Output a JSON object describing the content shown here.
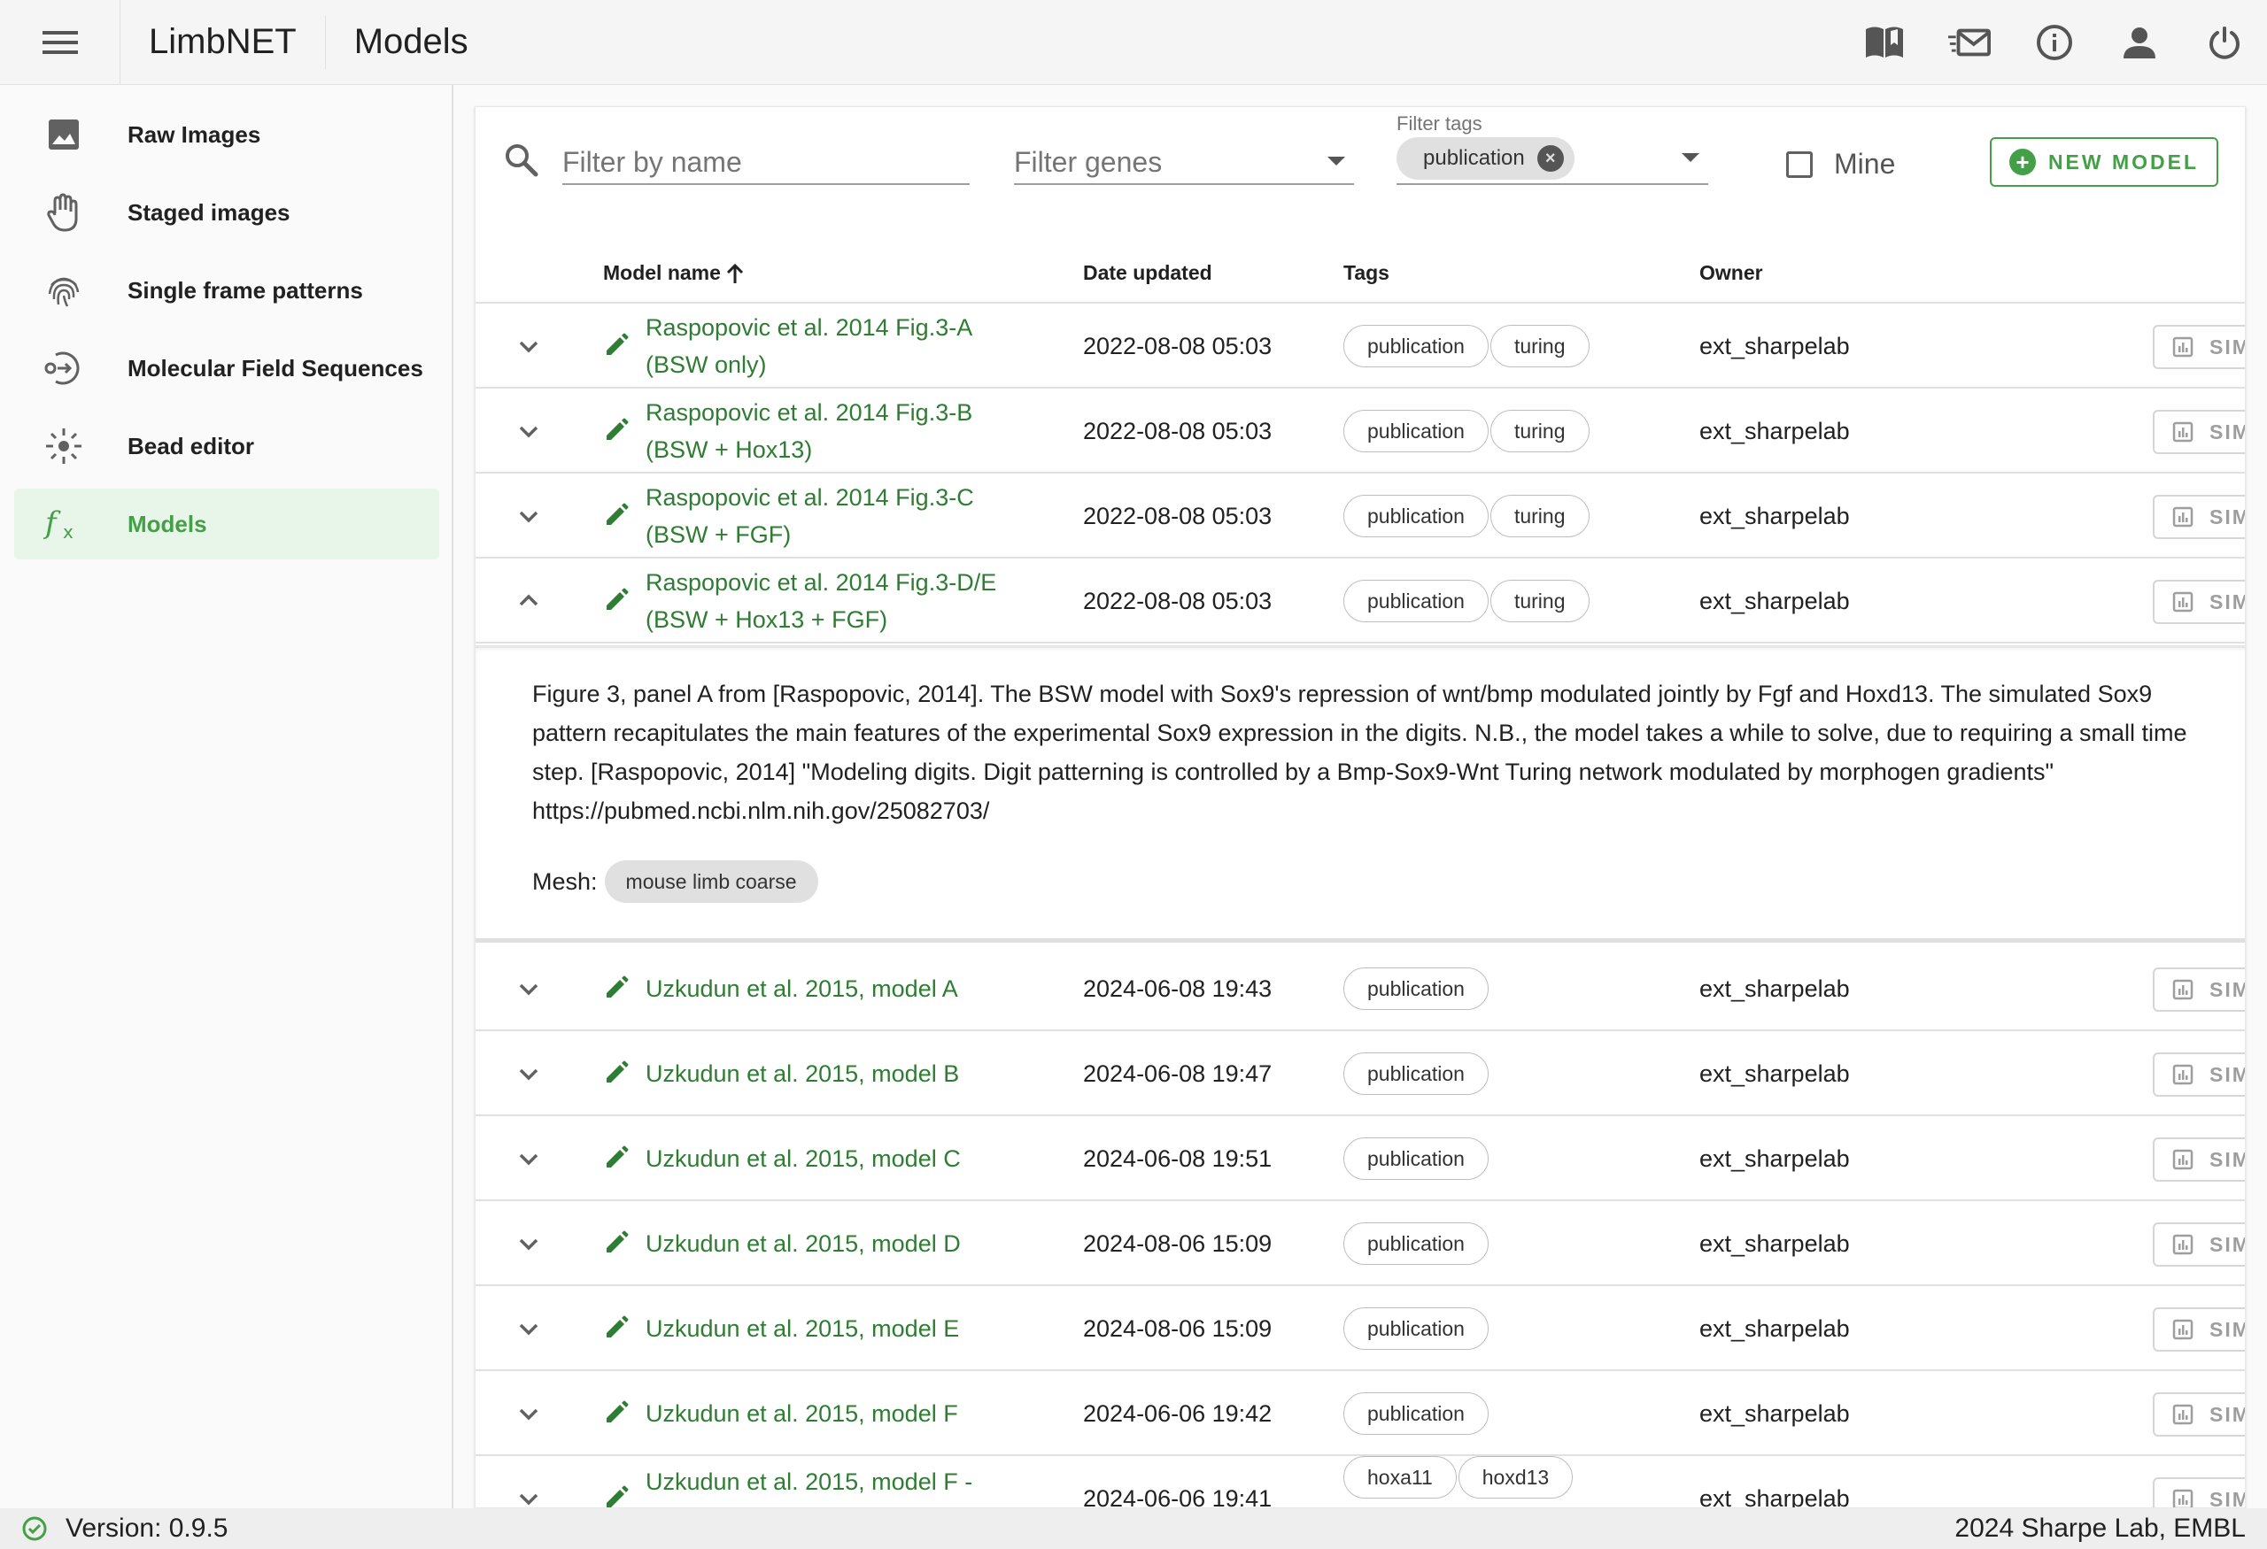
{
  "header": {
    "app_title": "LimbNET",
    "page_title": "Models",
    "icons": [
      "menu-icon",
      "book-icon",
      "mail-icon",
      "info-icon",
      "account-icon",
      "power-icon"
    ]
  },
  "sidebar": {
    "items": [
      {
        "label": "Raw Images",
        "icon": "image-icon"
      },
      {
        "label": "Staged images",
        "icon": "hand-icon"
      },
      {
        "label": "Single frame patterns",
        "icon": "fingerprint-icon"
      },
      {
        "label": "Molecular Field Sequences",
        "icon": "sequence-icon"
      },
      {
        "label": "Bead editor",
        "icon": "bead-icon"
      },
      {
        "label": "Models",
        "icon": "function-icon",
        "active": true
      }
    ]
  },
  "filters": {
    "name_placeholder": "Filter by name",
    "genes_placeholder": "Filter genes",
    "tags_label": "Filter tags",
    "tags_selected": [
      "publication"
    ],
    "mine_label": "Mine",
    "new_model_label": "NEW MODEL"
  },
  "table": {
    "headers": {
      "name": "Model name",
      "date": "Date updated",
      "tags": "Tags",
      "owner": "Owner"
    },
    "sim_label": "SIM",
    "rows": [
      {
        "name": "Raspopovic et al. 2014 Fig.3-A (BSW only)",
        "date": "2022-08-08 05:03",
        "tags": [
          "publication",
          "turing"
        ],
        "owner": "ext_sharpelab"
      },
      {
        "name": "Raspopovic et al. 2014 Fig.3-B (BSW + Hox13)",
        "date": "2022-08-08 05:03",
        "tags": [
          "publication",
          "turing"
        ],
        "owner": "ext_sharpelab"
      },
      {
        "name": "Raspopovic et al. 2014 Fig.3-C (BSW + FGF)",
        "date": "2022-08-08 05:03",
        "tags": [
          "publication",
          "turing"
        ],
        "owner": "ext_sharpelab"
      },
      {
        "name": "Raspopovic et al. 2014 Fig.3-D/E (BSW + Hox13 + FGF)",
        "date": "2022-08-08 05:03",
        "tags": [
          "publication",
          "turing"
        ],
        "owner": "ext_sharpelab",
        "expanded": true
      },
      {
        "name": "Uzkudun et al. 2015, model A",
        "date": "2024-06-08 19:43",
        "tags": [
          "publication"
        ],
        "owner": "ext_sharpelab"
      },
      {
        "name": "Uzkudun et al. 2015, model B",
        "date": "2024-06-08 19:47",
        "tags": [
          "publication"
        ],
        "owner": "ext_sharpelab"
      },
      {
        "name": "Uzkudun et al. 2015, model C",
        "date": "2024-06-08 19:51",
        "tags": [
          "publication"
        ],
        "owner": "ext_sharpelab"
      },
      {
        "name": "Uzkudun et al. 2015, model D",
        "date": "2024-08-06 15:09",
        "tags": [
          "publication"
        ],
        "owner": "ext_sharpelab"
      },
      {
        "name": "Uzkudun et al. 2015, model E",
        "date": "2024-08-06 15:09",
        "tags": [
          "publication"
        ],
        "owner": "ext_sharpelab"
      },
      {
        "name": "Uzkudun et al. 2015, model F",
        "date": "2024-06-06 19:42",
        "tags": [
          "publication"
        ],
        "owner": "ext_sharpelab"
      },
      {
        "name": "Uzkudun et al. 2015, model F -",
        "date": "2024-06-06 19:41",
        "tags": [
          "hoxa11",
          "hoxd13"
        ],
        "owner": "ext_sharpelab"
      }
    ],
    "detail": {
      "description": "Figure 3, panel A from [Raspopovic, 2014]. The BSW model with Sox9's repression of wnt/bmp modulated jointly by Fgf and Hoxd13. The simulated Sox9 pattern recapitulates the main features of the experimental Sox9 expression in the digits. N.B., the model takes a while to solve, due to requiring a small time step. [Raspopovic, 2014] \"Modeling digits. Digit patterning is controlled by a Bmp-Sox9-Wnt Turing network modulated by morphogen gradients\" https://pubmed.ncbi.nlm.nih.gov/25082703/",
      "mesh_label": "Mesh:",
      "mesh_value": "mouse limb coarse"
    }
  },
  "footer": {
    "version": "Version: 0.9.5",
    "copyright": "2024 Sharpe Lab, EMBL"
  },
  "colors": {
    "accent": "#43a047",
    "link": "#2e7d32",
    "active_bg": "#e8f5e9"
  }
}
